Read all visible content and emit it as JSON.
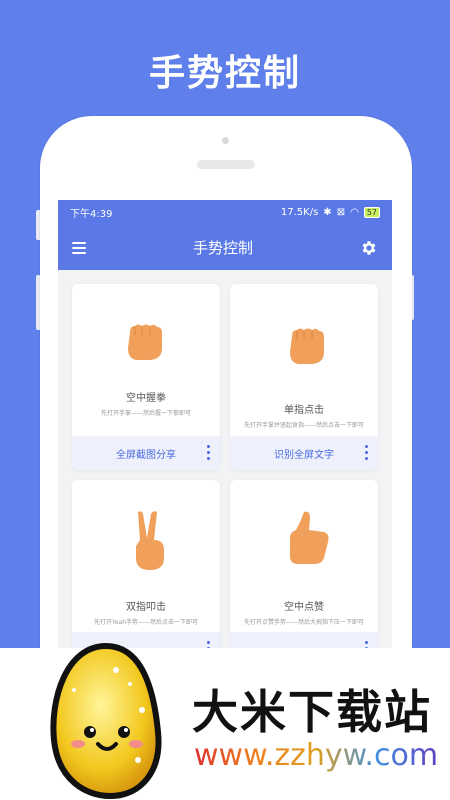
{
  "banner": {
    "title": "手势控制"
  },
  "status": {
    "time": "下午4:39",
    "speed": "17.5K/s",
    "battery": "57"
  },
  "appbar": {
    "title": "手势控制",
    "menu_icon": "hamburger-menu-icon",
    "settings_icon": "gear-icon"
  },
  "cards": [
    {
      "title": "空中握拳",
      "desc": "先打开手掌——然后握一下拳即可",
      "action": "全屏截图分享",
      "icon": "fist-hand-icon"
    },
    {
      "title": "单指点击",
      "desc": "先打开手掌并竖起食指——然后点击一下即可",
      "action": "识别全屏文字",
      "icon": "fist-hand-icon"
    },
    {
      "title": "双指叩击",
      "desc": "先打开Yeah手势——然后点击一下即可",
      "action": "",
      "icon": "victory-hand-icon"
    },
    {
      "title": "空中点赞",
      "desc": "先打开点赞手势——然后大拇指下压一下即可",
      "action": "",
      "icon": "thumbs-up-icon"
    }
  ],
  "watermark": {
    "name": "大米下载站",
    "url": "www.zzhyw.com"
  },
  "colors": {
    "brand": "#5f7fea",
    "appbar": "#5a79e6",
    "hand": "#f0a05a",
    "accent": "#4a6ae0"
  }
}
